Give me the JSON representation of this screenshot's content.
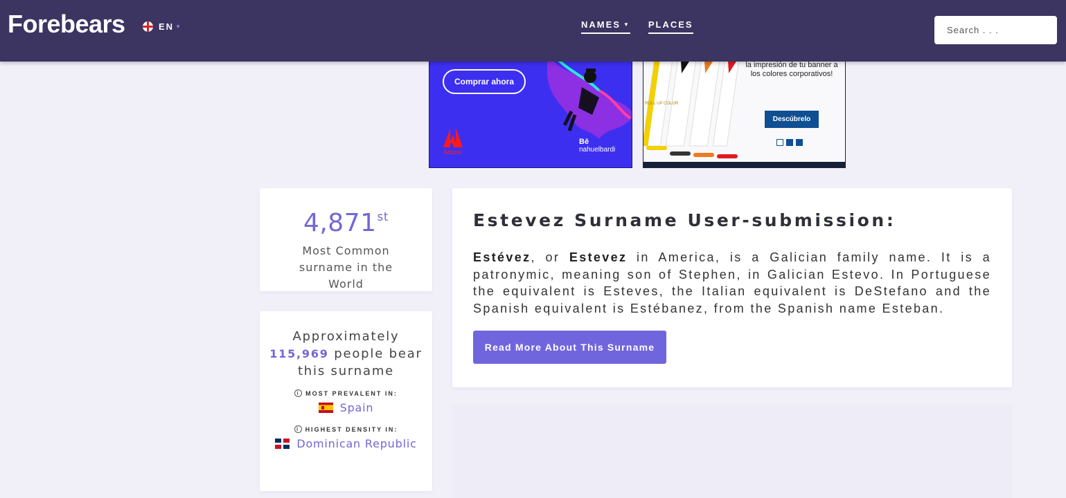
{
  "header": {
    "logo": "Forebears",
    "language": "EN",
    "nav": [
      {
        "label": "NAMES",
        "has_dropdown": true
      },
      {
        "label": "PLACES",
        "has_dropdown": false
      }
    ],
    "search_placeholder": "Search . . ."
  },
  "ads": {
    "adobe": {
      "button_label": "Comprar ahora",
      "brand": "Adobe",
      "behance_mark": "Bē",
      "artist": "nahuelbardi"
    },
    "rollup": {
      "text": "Podés adaptar perfectamente la impresión de tu banner a los colores corporativos!",
      "button_label": "Descúbrelo",
      "roll_label": "ROLL UP COLOR"
    }
  },
  "rank": {
    "number": "4,871",
    "suffix": "st",
    "description": "Most Common surname in the World"
  },
  "population": {
    "prefix": "Approximately",
    "count": "115,969",
    "suffix": "people bear this surname",
    "most_prevalent_heading": "MOST PREVALENT IN:",
    "most_prevalent_country": "Spain",
    "highest_density_heading": "HIGHEST DENSITY IN:",
    "highest_density_country": "Dominican Republic"
  },
  "submission": {
    "title": "Estevez Surname User-submission:",
    "name_1": "Estévez",
    "connector": ", or ",
    "name_2": "Estevez",
    "body": " in America, is a Galician family name. It is a patronymic, meaning son of Stephen, in Galician Estevo. In Portuguese the equivalent is Esteves, the Italian equivalent is DeStefano and the Spanish equivalent is Estébanez, from the Spanish name Esteban.",
    "button_label": "Read More About This Surname"
  },
  "colors": {
    "header_bg": "#3c3461",
    "accent": "#7167d6",
    "page_bg": "#f1f0f9"
  }
}
